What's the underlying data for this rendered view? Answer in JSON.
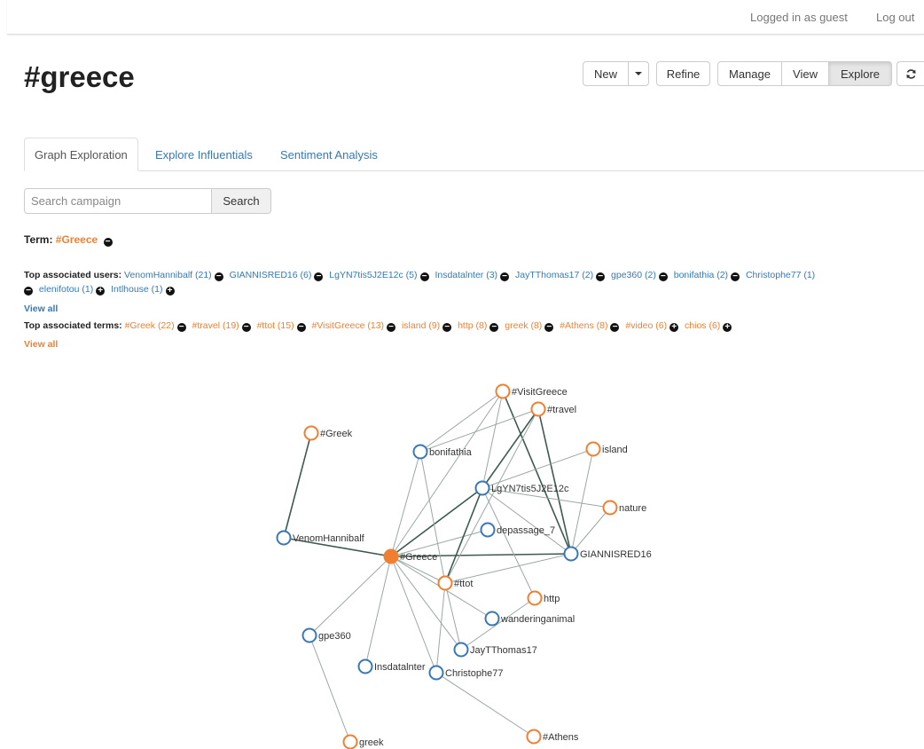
{
  "header": {
    "logged_in_text": "Logged in as guest",
    "logout_label": "Log out"
  },
  "page": {
    "title": "#greece"
  },
  "toolbar": {
    "new_label": "New",
    "refine_label": "Refine",
    "manage_label": "Manage",
    "view_label": "View",
    "explore_label": "Explore"
  },
  "tabs": [
    {
      "label": "Graph Exploration"
    },
    {
      "label": "Explore Influentials"
    },
    {
      "label": "Sentiment Analysis"
    }
  ],
  "search": {
    "placeholder": "Search campaign",
    "button_label": "Search"
  },
  "term": {
    "label": "Term:",
    "value": "#Greece"
  },
  "users": {
    "label": "Top associated users:",
    "items": [
      "VenomHannibalf (21)",
      "GIANNISRED16 (6)",
      "LgYN7tis5J2E12c (5)",
      "Insdatalnter (3)",
      "JayTThomas17 (2)",
      "gpe360 (2)",
      "bonifathia (2)",
      "Christophe77 (1)",
      "elenifotou (1)",
      "Intlhouse (1)"
    ],
    "view_all": "View all"
  },
  "terms": {
    "label": "Top associated terms:",
    "items": [
      "#Greek (22)",
      "#travel (19)",
      "#ttot (15)",
      "#VisitGreece (13)",
      "island (9)",
      "http (8)",
      "greek (8)",
      "#Athens (8)",
      "#video (6)",
      "chios (6)"
    ],
    "view_all": "View all"
  },
  "graph": {
    "colors": {
      "term": "#f08030",
      "user": "#3a78b5",
      "center": "#f08030"
    },
    "nodes": [
      {
        "id": "greece",
        "label": "#Greece",
        "type": "center"
      },
      {
        "id": "visitgreece",
        "label": "#VisitGreece",
        "type": "term"
      },
      {
        "id": "travel",
        "label": "#travel",
        "type": "term"
      },
      {
        "id": "greek_tag",
        "label": "#Greek",
        "type": "term"
      },
      {
        "id": "bonifathia",
        "label": "bonifathia",
        "type": "user"
      },
      {
        "id": "island",
        "label": "island",
        "type": "term"
      },
      {
        "id": "lgyn",
        "label": "LgYN7tis5J2E12c",
        "type": "user"
      },
      {
        "id": "nature",
        "label": "nature",
        "type": "term"
      },
      {
        "id": "venom",
        "label": "VenomHannibalf",
        "type": "user"
      },
      {
        "id": "depassage",
        "label": "depassage_7",
        "type": "user"
      },
      {
        "id": "giannis",
        "label": "GIANNISRED16",
        "type": "user"
      },
      {
        "id": "ttot",
        "label": "#ttot",
        "type": "term"
      },
      {
        "id": "http",
        "label": "http",
        "type": "term"
      },
      {
        "id": "wandering",
        "label": "wanderinganimal",
        "type": "user"
      },
      {
        "id": "gpe360",
        "label": "gpe360",
        "type": "user"
      },
      {
        "id": "jay",
        "label": "JayTThomas17",
        "type": "user"
      },
      {
        "id": "insdata",
        "label": "Insdatalnter",
        "type": "user"
      },
      {
        "id": "christophe",
        "label": "Christophe77",
        "type": "user"
      },
      {
        "id": "greek",
        "label": "greek",
        "type": "term"
      },
      {
        "id": "athens",
        "label": "#Athens",
        "type": "term"
      }
    ],
    "edges": [
      [
        "greek_tag",
        "venom"
      ],
      [
        "venom",
        "greece"
      ],
      [
        "greece",
        "bonifathia"
      ],
      [
        "greece",
        "lgyn"
      ],
      [
        "greece",
        "depassage"
      ],
      [
        "greece",
        "giannis"
      ],
      [
        "greece",
        "ttot"
      ],
      [
        "greece",
        "wandering"
      ],
      [
        "greece",
        "gpe360"
      ],
      [
        "greece",
        "jay"
      ],
      [
        "greece",
        "insdata"
      ],
      [
        "greece",
        "christophe"
      ],
      [
        "greece",
        "visitgreece"
      ],
      [
        "visitgreece",
        "bonifathia"
      ],
      [
        "visitgreece",
        "lgyn"
      ],
      [
        "visitgreece",
        "giannis"
      ],
      [
        "travel",
        "bonifathia"
      ],
      [
        "travel",
        "lgyn"
      ],
      [
        "travel",
        "giannis"
      ],
      [
        "travel",
        "ttot"
      ],
      [
        "bonifathia",
        "ttot"
      ],
      [
        "lgyn",
        "ttot"
      ],
      [
        "lgyn",
        "http"
      ],
      [
        "lgyn",
        "nature"
      ],
      [
        "lgyn",
        "island"
      ],
      [
        "giannis",
        "island"
      ],
      [
        "giannis",
        "nature"
      ],
      [
        "ttot",
        "giannis"
      ],
      [
        "ttot",
        "christophe"
      ],
      [
        "christophe",
        "athens"
      ],
      [
        "http",
        "jay"
      ],
      [
        "gpe360",
        "greek"
      ],
      [
        "lgyn",
        "giannis"
      ],
      [
        "ttot",
        "jay"
      ]
    ]
  }
}
